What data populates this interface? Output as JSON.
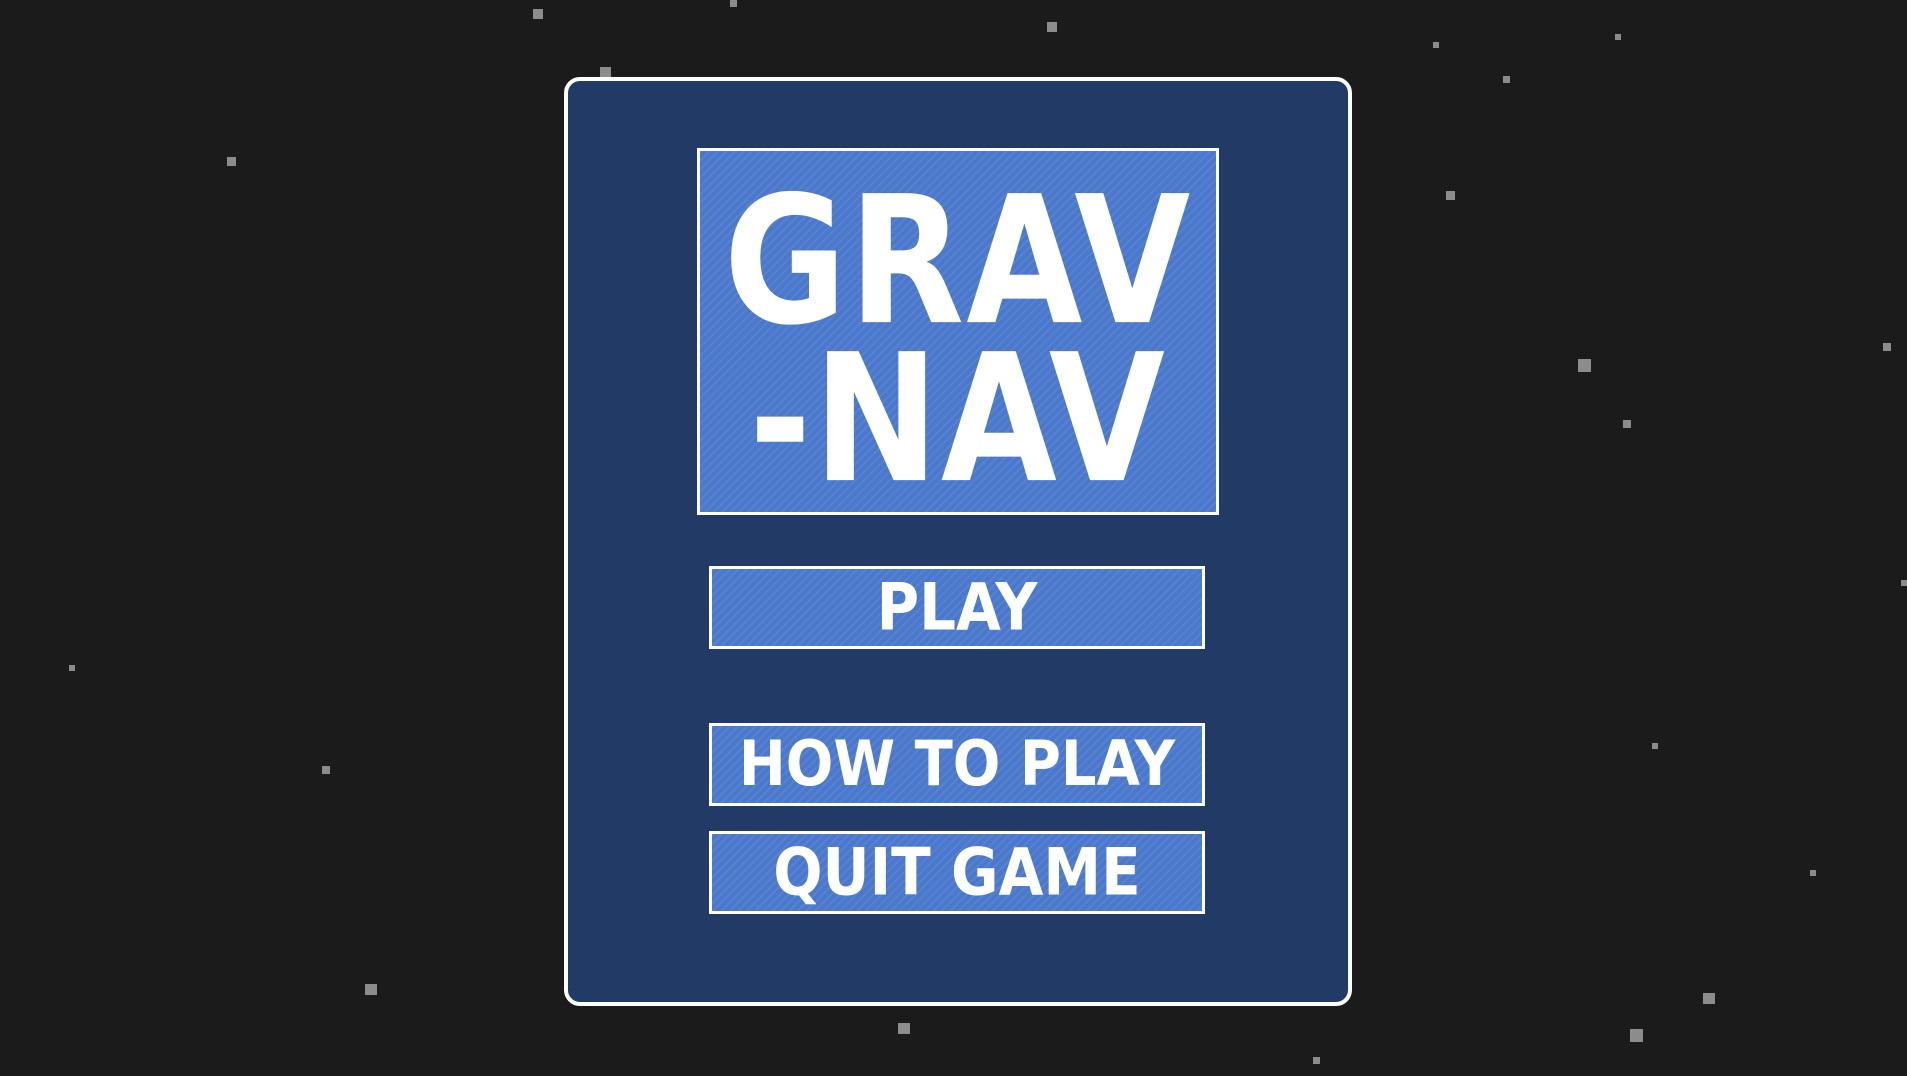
{
  "title": {
    "line1": "GRAV",
    "line2": "-NAV"
  },
  "menu": {
    "play_label": "PLAY",
    "how_to_play_label": "HOW TO PLAY",
    "quit_label": "QUIT GAME"
  },
  "colors": {
    "background": "#1b1b1b",
    "panel": "#213a66",
    "button_fill": "#4a78cc",
    "border": "#ffffff",
    "star": "#8c8c8c"
  }
}
